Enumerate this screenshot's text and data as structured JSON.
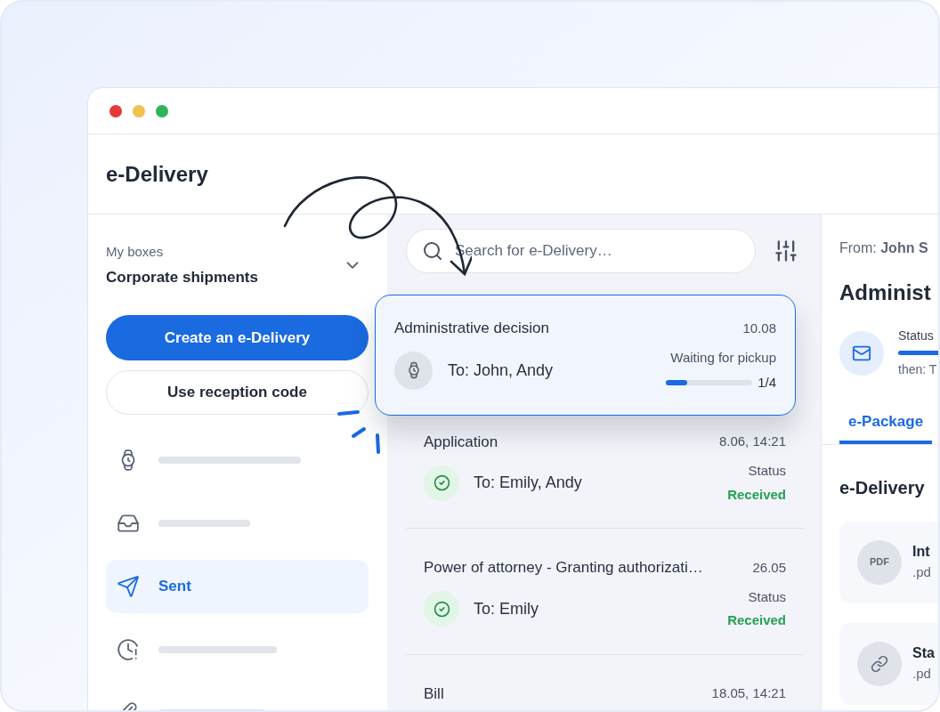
{
  "window": {
    "title": "e-Delivery"
  },
  "sidebar": {
    "box_label": "My boxes",
    "box_name": "Corporate shipments",
    "primary_button": "Create an e-Delivery",
    "secondary_button": "Use reception code",
    "items": [
      {
        "selected": false
      },
      {
        "selected": false
      },
      {
        "label": "Sent",
        "selected": true
      },
      {
        "selected": false
      },
      {
        "selected": false
      }
    ]
  },
  "search": {
    "placeholder": "Search for e-Delivery…"
  },
  "deliveries": [
    {
      "title": "Administrative decision",
      "date": "10.08",
      "recipients": "To: John, Andy",
      "kind": "waiting",
      "selected": true,
      "status": "Waiting for pickup",
      "level": 0.25,
      "count": "1/4"
    },
    {
      "title": "Application",
      "date": "8.06, 14:21",
      "recipients": "To: Emily, Andy",
      "kind": "received",
      "selected": false,
      "status_label": "Status",
      "status": "Received"
    },
    {
      "title": "Power of attorney - Granting authorizati…",
      "date": "26.05",
      "recipients": "To: Emily",
      "kind": "received",
      "selected": false,
      "status_label": "Status",
      "status": "Received"
    },
    {
      "title": "Bill",
      "date": "18.05, 14:21",
      "selected": false
    }
  ],
  "detail": {
    "from": "From: **John S**",
    "title": "Administ",
    "status_label": "Status",
    "level": 1,
    "then": "then: T",
    "tabs": [
      {
        "label": "e-Package",
        "selected": true
      }
    ],
    "section_title": "e-Delivery",
    "files": [
      {
        "kind": "pdf",
        "badge": "PDF",
        "name": "Int",
        "ext": ".pd"
      },
      {
        "kind": "link",
        "name": "Sta",
        "ext": ".pd"
      }
    ]
  }
}
